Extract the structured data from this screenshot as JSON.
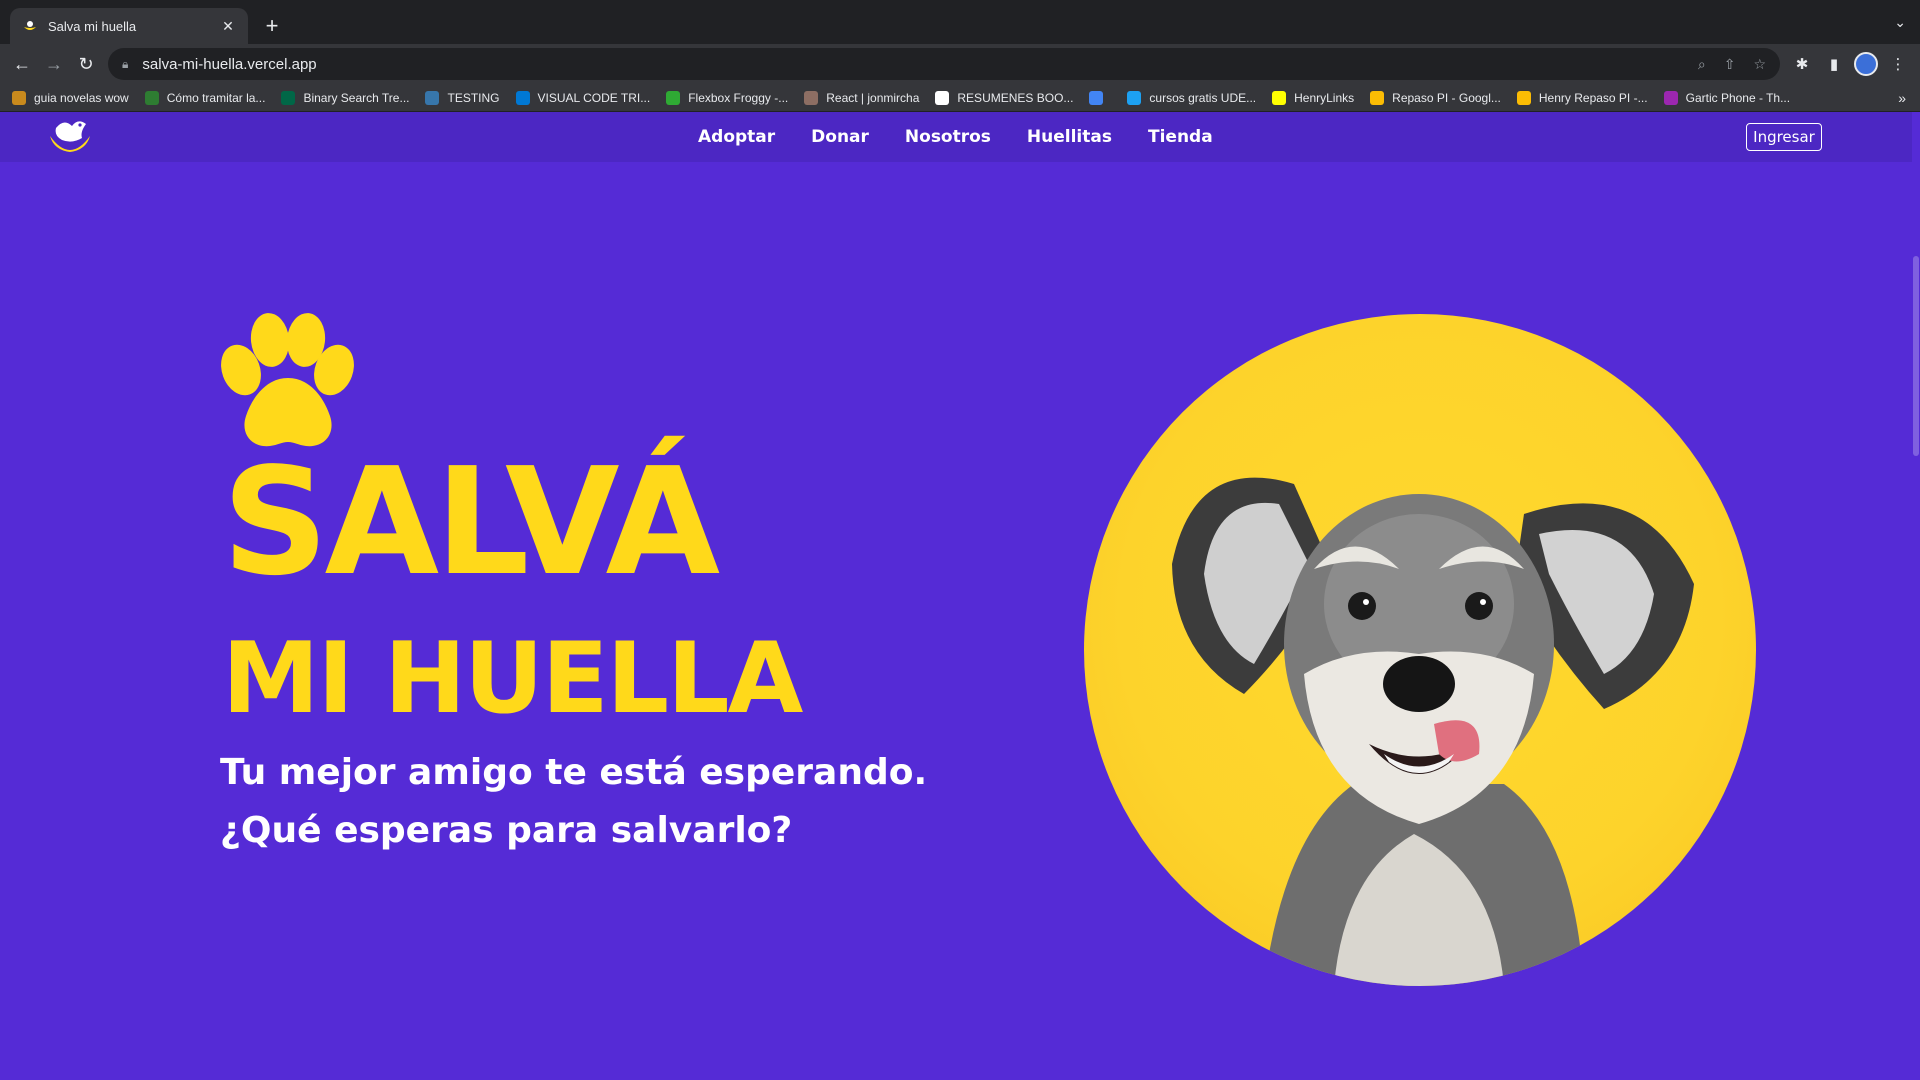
{
  "browser": {
    "tab_title": "Salva mi huella",
    "url": "salva-mi-huella.vercel.app",
    "bookmarks": [
      {
        "label": "guia novelas wow",
        "icon": "wow-icon",
        "color": "#c98a1d"
      },
      {
        "label": "Cómo tramitar la...",
        "icon": "flag-icon",
        "color": "#2e7d32"
      },
      {
        "label": "Binary Search Tre...",
        "icon": "usf-icon",
        "color": "#006747"
      },
      {
        "label": "TESTING",
        "icon": "python-icon",
        "color": "#3776ab"
      },
      {
        "label": "VISUAL CODE TRI...",
        "icon": "vscode-icon",
        "color": "#0078d4"
      },
      {
        "label": "Flexbox Froggy -...",
        "icon": "frog-icon",
        "color": "#2faa34"
      },
      {
        "label": "React | jonmircha",
        "icon": "avatar-icon",
        "color": "#8d6e63"
      },
      {
        "label": "RESUMENES BOO...",
        "icon": "notion-icon",
        "color": "#ffffff"
      },
      {
        "label": "",
        "icon": "loader-icon",
        "color": "#4285f4"
      },
      {
        "label": "cursos gratis UDE...",
        "icon": "twitter-icon",
        "color": "#1da1f2"
      },
      {
        "label": "HenryLinks",
        "icon": "henry-icon",
        "color": "#ffff01"
      },
      {
        "label": "Repaso PI - Googl...",
        "icon": "drive-icon",
        "color": "#fbbc04"
      },
      {
        "label": "Henry Repaso PI -...",
        "icon": "drive-icon",
        "color": "#fbbc04"
      },
      {
        "label": "Gartic Phone - Th...",
        "icon": "phone-icon",
        "color": "#9c27b0"
      }
    ]
  },
  "site": {
    "nav": [
      "Adoptar",
      "Donar",
      "Nosotros",
      "Huellitas",
      "Tienda"
    ],
    "login_label": "Ingresar",
    "hero": {
      "title_line1": "SALVÁ",
      "title_line2": "MI HUELLA",
      "subtitle_line1": "Tu mejor amigo te está esperando.",
      "subtitle_line2": "¿Qué esperas para salvarlo?"
    },
    "colors": {
      "background": "#552bd6",
      "nav": "#4c27c3",
      "accent": "#ffd91a"
    }
  }
}
